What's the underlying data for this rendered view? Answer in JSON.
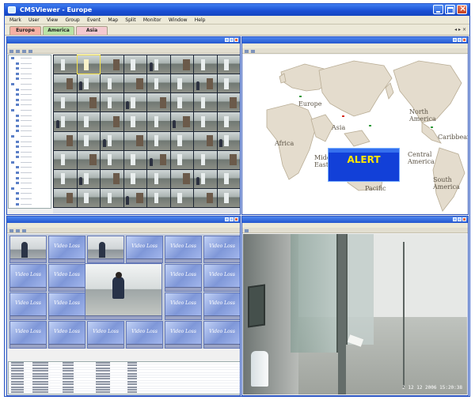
{
  "window": {
    "title": "CMSViewer - Europe"
  },
  "menu": [
    "Mark",
    "User",
    "View",
    "Group",
    "Event",
    "Map",
    "Split",
    "Monitor",
    "Window",
    "Help"
  ],
  "tabs": [
    "Europe",
    "America",
    "Asia"
  ],
  "map": {
    "labels": [
      "Europe",
      "Asia",
      "Africa",
      "Middle East",
      "Pacific",
      "North America",
      "Central America",
      "Caribbean",
      "South America"
    ]
  },
  "alert": {
    "title": "ALERT"
  },
  "video_loss_label": "Video Loss",
  "live_view": {
    "timestamp": "2 12 12 2006 15:20:38"
  },
  "colors": {
    "titlebar": "#1a4fd4",
    "alert_bg": "#1240d8",
    "alert_text": "#ffe600",
    "tab_active": "#f6b0a4"
  }
}
